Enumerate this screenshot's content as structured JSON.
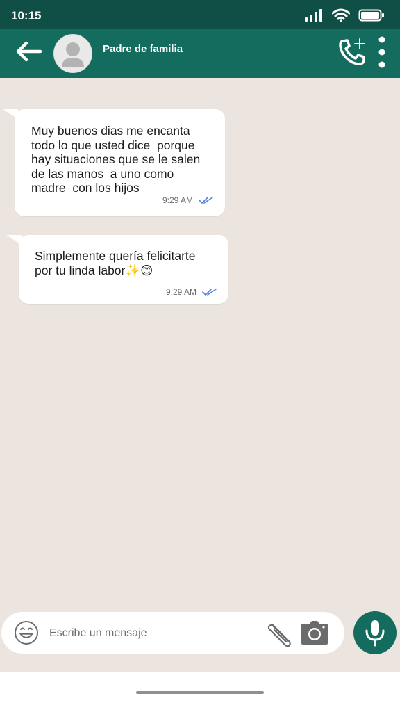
{
  "status_bar": {
    "time": "10:15",
    "icons": [
      "signal-icon",
      "wifi-icon",
      "battery-icon"
    ]
  },
  "header": {
    "contact_name": "Padre de familia",
    "icons": [
      "back-arrow-icon",
      "default-avatar-icon",
      "add-call-icon",
      "more-vertical-icon"
    ]
  },
  "messages": [
    {
      "text": "Muy buenos dias me encanta\ntodo lo que usted dice  porque\nhay situaciones que se le salen\nde las manos  a uno como\nmadre  con los hijos",
      "time": "9:29 AM",
      "status": "read"
    },
    {
      "text": "Simplemente quería felicitarte\npor tu linda labor✨😊",
      "time": "9:29 AM",
      "status": "read"
    }
  ],
  "composer": {
    "placeholder": "Escribe un mensaje",
    "value": "",
    "icons": [
      "emoji-icon",
      "paperclip-icon",
      "camera-icon",
      "microphone-icon"
    ]
  },
  "colors": {
    "status_bar": "#0f4f45",
    "header": "#136c5d",
    "chat_background": "#ece5df",
    "bubble": "#ffffff",
    "read_ticks": "#4f7fe0",
    "mic_button": "#136c5d"
  }
}
